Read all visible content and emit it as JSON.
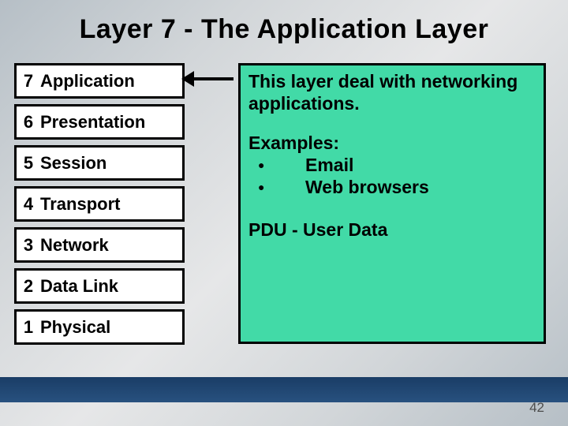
{
  "title": "Layer 7 - The Application Layer",
  "layers": [
    {
      "num": "7",
      "name": "Application"
    },
    {
      "num": "6",
      "name": "Presentation"
    },
    {
      "num": "5",
      "name": "Session"
    },
    {
      "num": "4",
      "name": "Transport"
    },
    {
      "num": "3",
      "name": "Network"
    },
    {
      "num": "2",
      "name": "Data Link"
    },
    {
      "num": "1",
      "name": "Physical"
    }
  ],
  "description": {
    "summary": "This layer deal with networking applications.",
    "examples_label": "Examples:",
    "examples": [
      "Email",
      "Web browsers"
    ],
    "pdu": "PDU - User Data"
  },
  "page_number": "42"
}
